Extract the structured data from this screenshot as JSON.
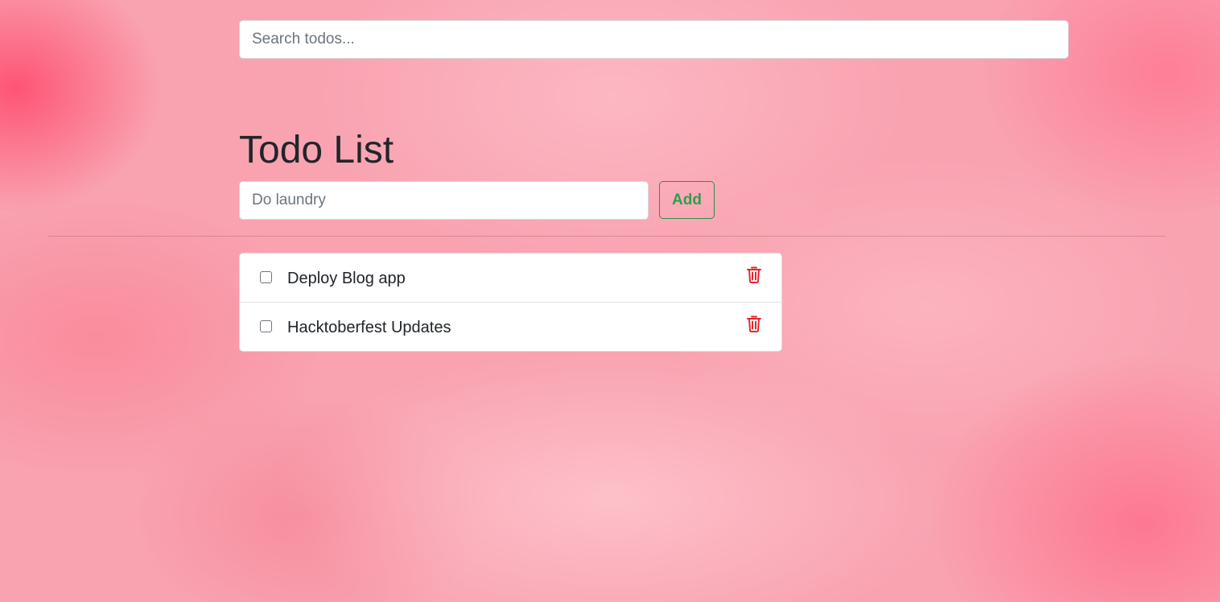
{
  "search": {
    "placeholder": "Search todos...",
    "value": ""
  },
  "header": {
    "title": "Todo List"
  },
  "add_form": {
    "placeholder": "Do laundry",
    "value": "",
    "add_label": "Add"
  },
  "todos": [
    {
      "text": "Deploy Blog app",
      "checked": false,
      "delete_icon": "trash-icon"
    },
    {
      "text": "Hacktoberfest Updates",
      "checked": false,
      "delete_icon": "trash-icon"
    }
  ],
  "colors": {
    "accent_add": "#2f9e4a",
    "delete": "#e3262c",
    "background": "#f9a3b1"
  }
}
